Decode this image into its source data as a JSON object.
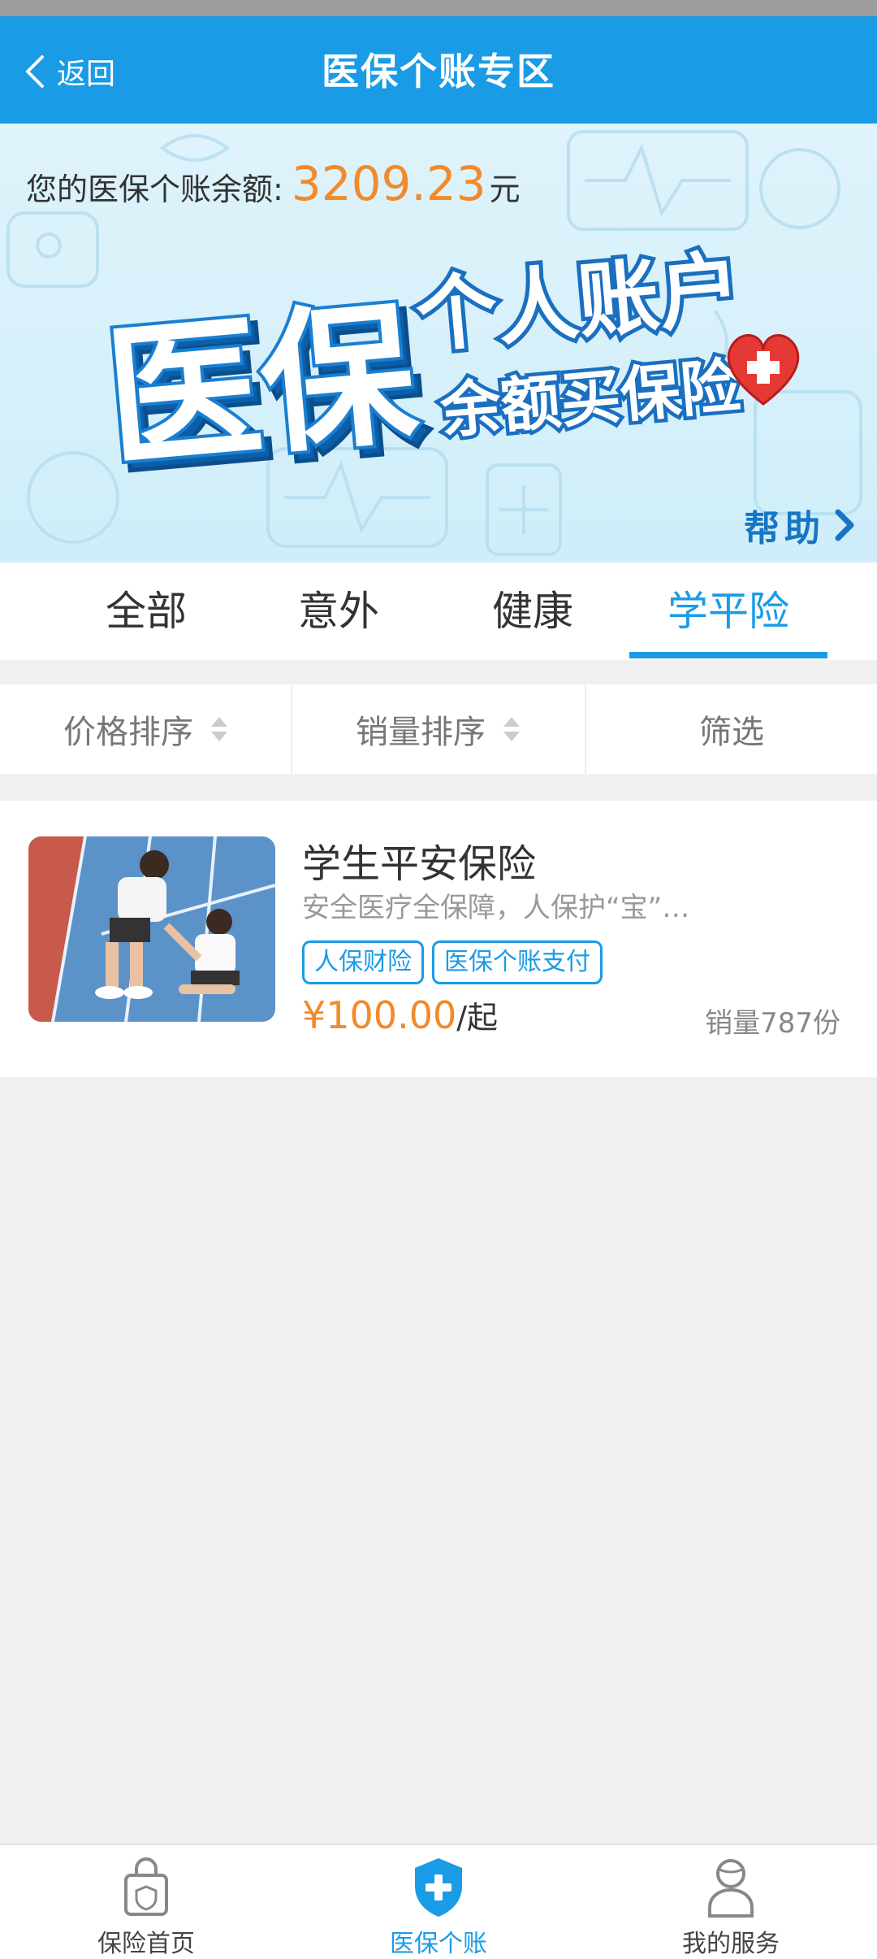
{
  "nav": {
    "back_label": "返回",
    "title": "医保个账专区"
  },
  "banner": {
    "balance_label": "您的医保个账余额:",
    "balance_amount": "3209.23",
    "balance_unit": "元",
    "headline_main": "医保",
    "headline_sub": "个人账户",
    "headline_tag": "余额买保险",
    "help_label": "帮助"
  },
  "tabs": [
    {
      "label": "全部"
    },
    {
      "label": "意外"
    },
    {
      "label": "健康"
    },
    {
      "label": "学平险",
      "active": true
    }
  ],
  "sort": {
    "price_label": "价格排序",
    "sales_label": "销量排序",
    "filter_label": "筛选"
  },
  "product": {
    "name": "学生平安保险",
    "description": "安全医疗全保障，人保护“宝”…",
    "tags": [
      "人保财险",
      "医保个账支付"
    ],
    "price": "¥100.00",
    "price_suffix": "/起",
    "sales": "销量787份"
  },
  "bottom_tabs": [
    {
      "label": "保险首页",
      "icon": "bag-icon"
    },
    {
      "label": "医保个账",
      "icon": "shield-cross-icon",
      "active": true
    },
    {
      "label": "我的服务",
      "icon": "user-icon"
    }
  ],
  "colors": {
    "primary": "#1a9be6",
    "price": "#f28a2a",
    "background": "#f0f0f0"
  }
}
